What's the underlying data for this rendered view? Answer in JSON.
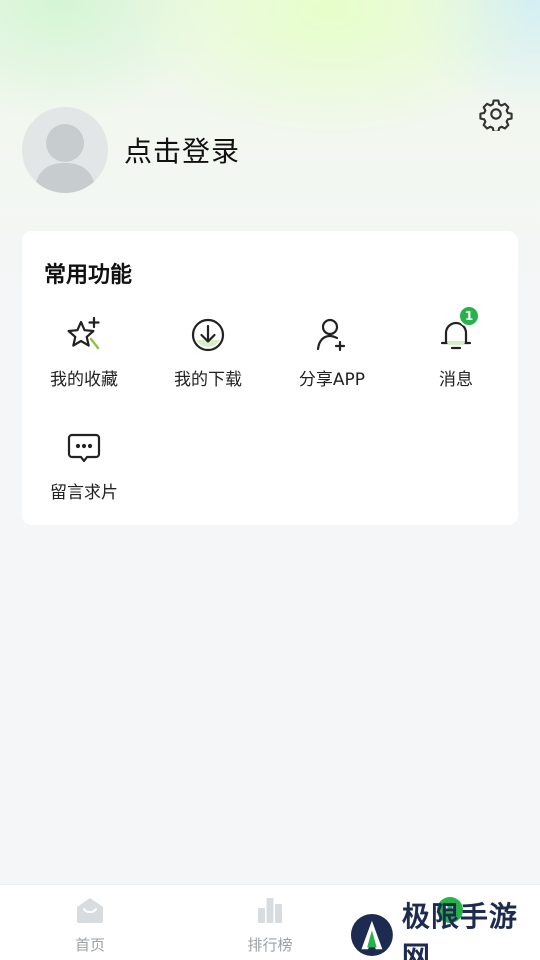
{
  "header": {
    "login_text": "点击登录"
  },
  "functions": {
    "title": "常用功能",
    "items": [
      {
        "label": "我的收藏",
        "icon": "star-icon"
      },
      {
        "label": "我的下载",
        "icon": "download-icon"
      },
      {
        "label": "分享APP",
        "icon": "add-user-icon"
      },
      {
        "label": "消息",
        "icon": "bell-icon",
        "badge": "1"
      },
      {
        "label": "留言求片",
        "icon": "chat-bubble-icon"
      }
    ]
  },
  "tabbar": {
    "items": [
      {
        "label": "首页",
        "icon": "home-icon"
      },
      {
        "label": "排行榜",
        "icon": "ranking-icon"
      },
      {
        "label": "",
        "icon": "profile-icon"
      }
    ]
  },
  "watermark": {
    "text": "极限手游网"
  },
  "colors": {
    "accent": "#27b24a",
    "background": "#f4f6f8",
    "tab_inactive": "#9aa0a6"
  }
}
